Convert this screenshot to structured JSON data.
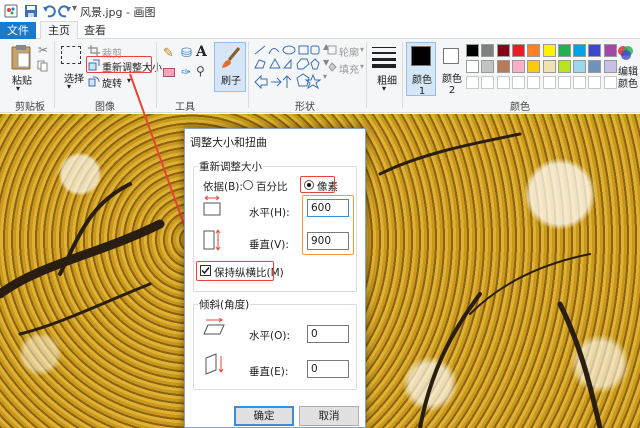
{
  "window": {
    "title": "风景.jpg - 画图"
  },
  "tabs": {
    "file": "文件",
    "home": "主页",
    "view": "查看"
  },
  "ribbon": {
    "clipboard": {
      "paste": "粘贴",
      "group": "剪贴板"
    },
    "image": {
      "select": "选择",
      "crop": "裁剪",
      "resize": "重新调整大小",
      "rotate": "旋转",
      "group": "图像"
    },
    "tools": {
      "group": "工具"
    },
    "brushes": {
      "label": "刷子"
    },
    "shapes": {
      "outline": "轮廓",
      "fill": "填充",
      "group": "形状"
    },
    "size": {
      "label": "粗细"
    },
    "colors": {
      "color1": "颜色 1",
      "color2": "颜色 2",
      "edit": "编辑颜色",
      "group": "颜色",
      "palette_row1": [
        "#000000",
        "#7f7f7f",
        "#880015",
        "#ed1c24",
        "#ff7f27",
        "#fff200",
        "#22b14c",
        "#00a2e8",
        "#3f48cc",
        "#a349a4"
      ],
      "palette_row2": [
        "#ffffff",
        "#c3c3c3",
        "#b97a57",
        "#ffaec9",
        "#ffc90e",
        "#efe4b0",
        "#b5e61d",
        "#99d9ea",
        "#7092be",
        "#c8bfe7"
      ],
      "color1_value": "#000000",
      "color2_value": "#ffffff",
      "accent": "#1979ca"
    }
  },
  "dialog": {
    "title": "调整大小和扭曲",
    "resize": {
      "legend": "重新调整大小",
      "by_label": "依据(B):",
      "percent": "百分比",
      "pixels": "像素",
      "selected": "pixels",
      "horizontal_label": "水平(H):",
      "horizontal_value": "600",
      "vertical_label": "垂直(V):",
      "vertical_value": "900",
      "keep_ratio": "保持纵横比(M)",
      "keep_ratio_checked": true
    },
    "skew": {
      "legend": "倾斜(角度)",
      "horizontal_label": "水平(O):",
      "horizontal_value": "0",
      "vertical_label": "垂直(E):",
      "vertical_value": "0"
    },
    "ok": "确定",
    "cancel": "取消"
  }
}
